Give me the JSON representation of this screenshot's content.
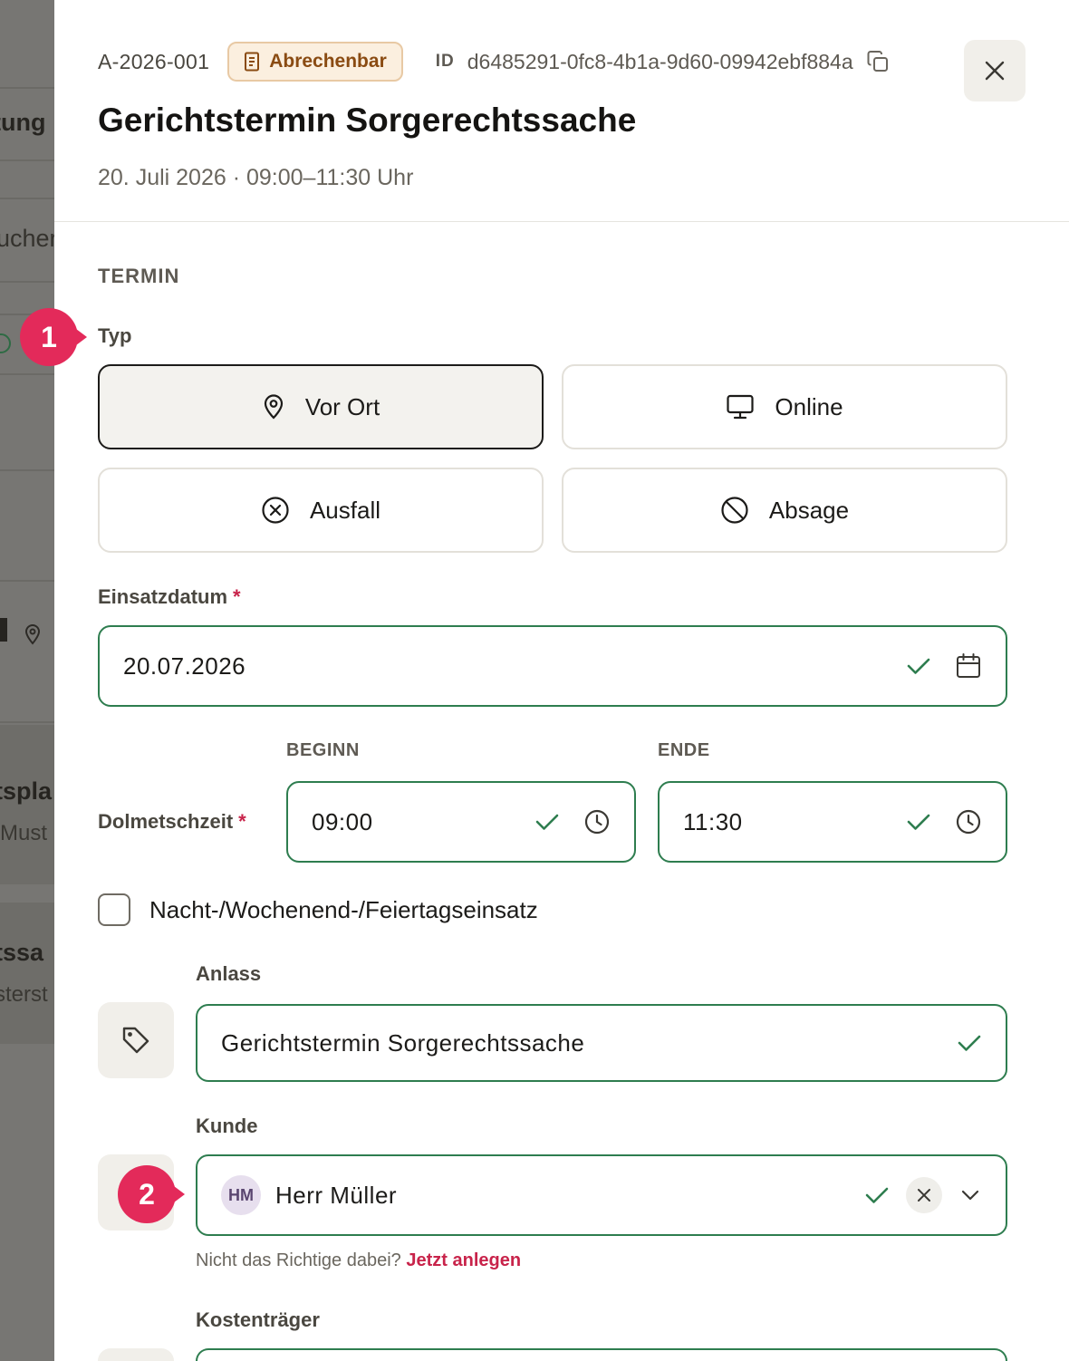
{
  "background": {
    "fragments": [
      "tung",
      "ucher",
      "tspla",
      "Must",
      "tssa",
      "sterst"
    ]
  },
  "header": {
    "code": "A-2026-001",
    "badge": "Abrechenbar",
    "id_label": "ID",
    "id_value": "d6485291-0fc8-4b1a-9d60-09942ebf884a",
    "title": "Gerichtstermin Sorgerechtssache",
    "subtitle": "20. Juli 2026 · 09:00–11:30 Uhr"
  },
  "section": {
    "title": "TERMIN"
  },
  "type": {
    "label": "Typ",
    "options": [
      {
        "label": "Vor Ort",
        "icon": "map-pin-icon",
        "selected": true
      },
      {
        "label": "Online",
        "icon": "monitor-icon",
        "selected": false
      },
      {
        "label": "Ausfall",
        "icon": "x-circle-icon",
        "selected": false
      },
      {
        "label": "Absage",
        "icon": "ban-icon",
        "selected": false
      }
    ]
  },
  "date": {
    "label": "Einsatzdatum",
    "required_mark": "*",
    "value": "20.07.2026"
  },
  "time": {
    "label": "Dolmetschzeit",
    "required_mark": "*",
    "begin_label": "BEGINN",
    "begin_value": "09:00",
    "end_label": "ENDE",
    "end_value": "11:30"
  },
  "night": {
    "label": "Nacht-/Wochenend-/Feiertagseinsatz",
    "checked": false
  },
  "occasion": {
    "label": "Anlass",
    "value": "Gerichtstermin Sorgerechtssache"
  },
  "customer": {
    "label": "Kunde",
    "initials": "HM",
    "value": "Herr Müller",
    "hint": "Nicht das Richtige dabei?",
    "hint_link": "Jetzt anlegen"
  },
  "payer": {
    "label": "Kostenträger"
  },
  "callouts": [
    "1",
    "2"
  ],
  "colors": {
    "valid": "#2e7d4f",
    "accent": "#e32a5a",
    "required": "#c8234a",
    "badge_bg": "#fbefdf",
    "badge_text": "#8a4b12"
  }
}
